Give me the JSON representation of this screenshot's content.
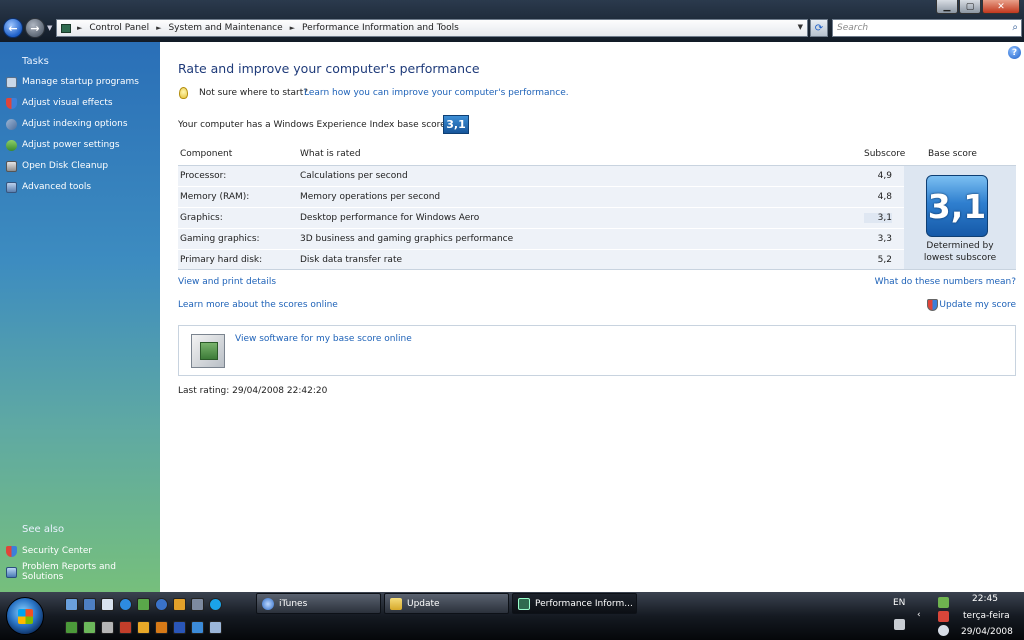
{
  "window": {
    "minimize_label": "▁",
    "maximize_label": "▢",
    "close_label": "✕"
  },
  "address": {
    "crumbs": [
      "Control Panel",
      "System and Maintenance",
      "Performance Information and Tools"
    ],
    "search_placeholder": "Search"
  },
  "sidebar": {
    "tasks_heading": "Tasks",
    "tasks": [
      {
        "label": "Manage startup programs",
        "icon": "startup-icon"
      },
      {
        "label": "Adjust visual effects",
        "icon": "shield-icon"
      },
      {
        "label": "Adjust indexing options",
        "icon": "indexing-icon"
      },
      {
        "label": "Adjust power settings",
        "icon": "power-icon"
      },
      {
        "label": "Open Disk Cleanup",
        "icon": "disk-cleanup-icon"
      },
      {
        "label": "Advanced tools",
        "icon": "tools-icon"
      }
    ],
    "see_also_heading": "See also",
    "see_also": [
      {
        "label": "Security Center",
        "icon": "security-center-icon"
      },
      {
        "label": "Problem Reports and Solutions",
        "icon": "problem-reports-icon"
      }
    ]
  },
  "main": {
    "heading": "Rate and improve your computer's performance",
    "tip_text": "Not sure where to start?",
    "tip_link": "Learn how you can improve your computer's performance.",
    "base_text": "Your computer has a Windows Experience Index base score of",
    "base_score": "3,1",
    "columns": {
      "component": "Component",
      "rated": "What is rated",
      "subscore": "Subscore",
      "base": "Base score"
    },
    "rows": [
      {
        "component": "Processor:",
        "rated": "Calculations per second",
        "subscore": "4,9"
      },
      {
        "component": "Memory (RAM):",
        "rated": "Memory operations per second",
        "subscore": "4,8"
      },
      {
        "component": "Graphics:",
        "rated": "Desktop performance for Windows Aero",
        "subscore": "3,1"
      },
      {
        "component": "Gaming graphics:",
        "rated": "3D business and gaming graphics performance",
        "subscore": "3,3"
      },
      {
        "component": "Primary hard disk:",
        "rated": "Disk data transfer rate",
        "subscore": "5,2"
      }
    ],
    "big_score": "3,1",
    "determined_line1": "Determined by",
    "determined_line2": "lowest subscore",
    "view_print": "View and print details",
    "what_mean": "What do these numbers mean?",
    "learn_scores": "Learn more about the scores online",
    "update_score": "Update my score",
    "software_link": "View software for my base score online",
    "last_rating": "Last rating: 29/04/2008 22:42:20"
  },
  "taskbar": {
    "tasks": [
      {
        "label": "iTunes",
        "icon": "itunes-icon"
      },
      {
        "label": "Update",
        "icon": "folder-icon"
      },
      {
        "label": "Performance Inform...",
        "icon": "performance-icon"
      }
    ],
    "language": "EN",
    "time": "22:45",
    "day": "terça-feira",
    "date": "29/04/2008"
  }
}
